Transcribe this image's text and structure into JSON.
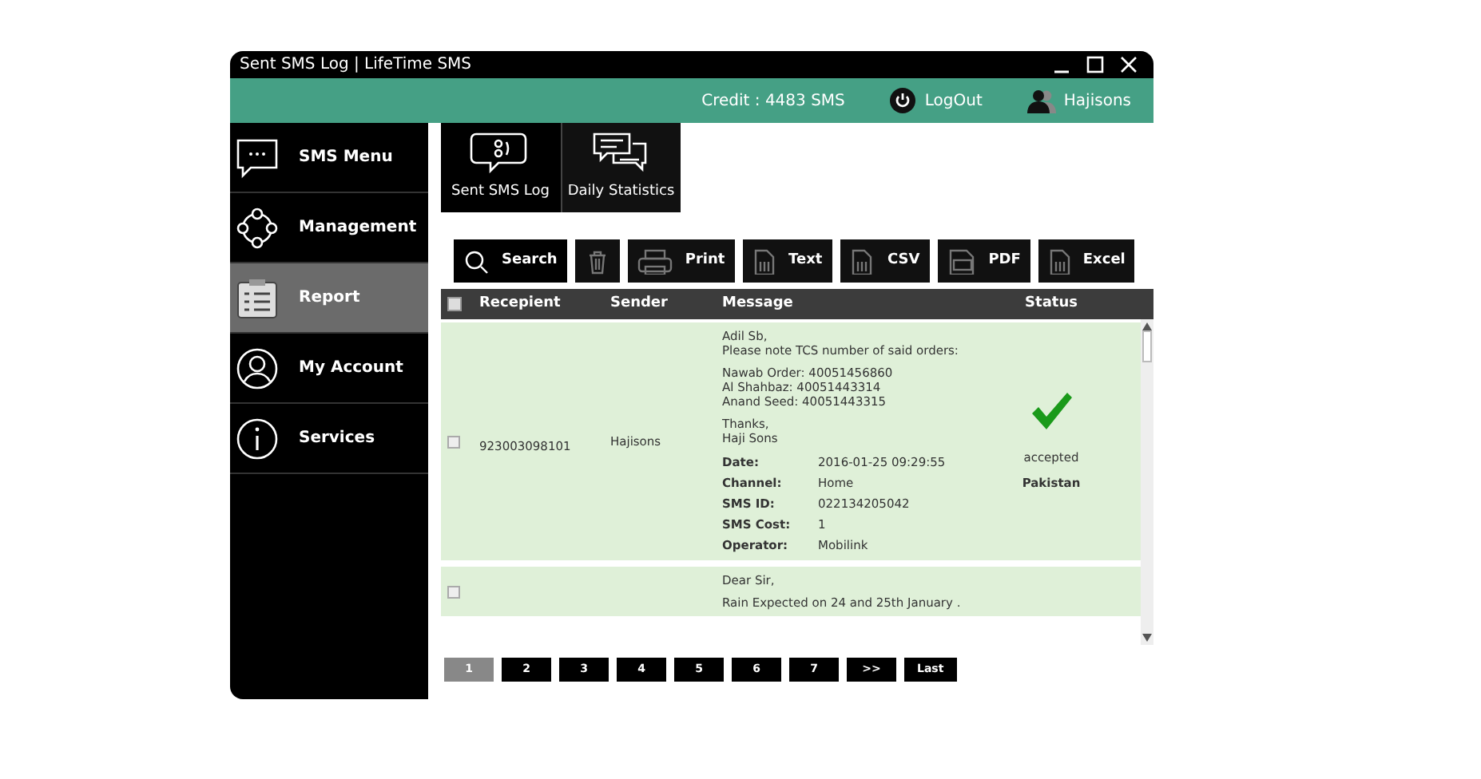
{
  "window": {
    "title": "Sent SMS Log | LifeTime SMS"
  },
  "header": {
    "credit": "Credit :  4483 SMS",
    "logout": "LogOut",
    "user": "Hajisons"
  },
  "sidebar": {
    "items": [
      {
        "label": "SMS Menu",
        "selected": false
      },
      {
        "label": "Management",
        "selected": false
      },
      {
        "label": "Report",
        "selected": true
      },
      {
        "label": "My Account",
        "selected": false
      },
      {
        "label": "Services",
        "selected": false
      }
    ]
  },
  "tabs": [
    {
      "label": "Sent SMS Log",
      "selected": true
    },
    {
      "label": "Daily Statistics",
      "selected": false
    }
  ],
  "toolbar": [
    {
      "kind": "search",
      "label": "Search"
    },
    {
      "kind": "delete"
    },
    {
      "kind": "print",
      "label": "Print"
    },
    {
      "kind": "file",
      "label": "Text"
    },
    {
      "kind": "file",
      "label": "CSV"
    },
    {
      "kind": "pdf",
      "label": "PDF"
    },
    {
      "kind": "file",
      "label": "Excel"
    }
  ],
  "table": {
    "columns": [
      "Recepient",
      "Sender",
      "Message",
      "Status"
    ],
    "select_all_checked": false,
    "rows": [
      {
        "checked": false,
        "recipient": "923003098101",
        "sender": "Hajisons",
        "message": [
          [
            "Adil Sb,",
            "Please note TCS number of said orders:"
          ],
          [
            "Nawab Order: 40051456860",
            "Al Shahbaz: 40051443314",
            "Anand Seed: 40051443315"
          ],
          [
            "Thanks,",
            "Haji Sons"
          ]
        ],
        "details": [
          {
            "label": "Date:",
            "value": "2016-01-25 09:29:55"
          },
          {
            "label": "Channel:",
            "value": "Home"
          },
          {
            "label": "SMS ID:",
            "value": "022134205042"
          },
          {
            "label": "SMS Cost:",
            "value": "1"
          },
          {
            "label": "Operator:",
            "value": "Mobilink"
          }
        ],
        "status": "accepted",
        "accepted": true,
        "country": "Pakistan"
      },
      {
        "checked": false,
        "message": [
          [
            "Dear Sir,"
          ],
          [
            "Rain Expected on 24 and 25th January ."
          ]
        ]
      }
    ]
  },
  "pagination": [
    {
      "label": "1",
      "selected": true
    },
    {
      "label": "2",
      "selected": false
    },
    {
      "label": "3",
      "selected": false
    },
    {
      "label": "4",
      "selected": false
    },
    {
      "label": "5",
      "selected": false
    },
    {
      "label": "6",
      "selected": false
    },
    {
      "label": "7",
      "selected": false
    },
    {
      "label": ">>",
      "selected": false
    },
    {
      "label": "Last",
      "selected": false
    }
  ]
}
